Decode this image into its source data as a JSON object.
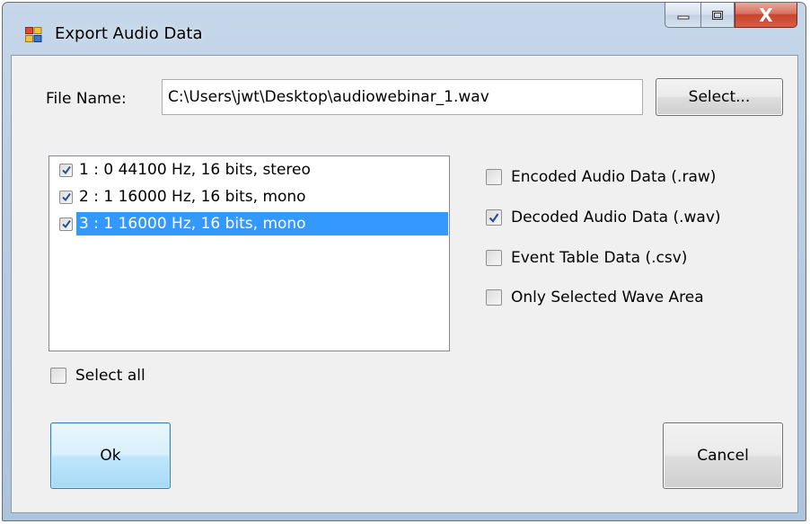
{
  "window": {
    "title": "Export Audio Data",
    "close_glyph": "X"
  },
  "file": {
    "label": "File Name:",
    "value": "C:\\Users\\jwt\\Desktop\\audiowebinar_1.wav",
    "select_label": "Select..."
  },
  "tracks": [
    {
      "label": "1 : 0 44100 Hz, 16 bits, stereo",
      "checked": true,
      "selected": false
    },
    {
      "label": "2 : 1 16000 Hz, 16 bits, mono",
      "checked": true,
      "selected": false
    },
    {
      "label": "3 : 1 16000 Hz, 16 bits, mono",
      "checked": true,
      "selected": true
    }
  ],
  "options": [
    {
      "label": "Encoded Audio Data (.raw)",
      "checked": false
    },
    {
      "label": "Decoded Audio Data (.wav)",
      "checked": true
    },
    {
      "label": "Event Table Data (.csv)",
      "checked": false
    },
    {
      "label": "Only Selected Wave Area",
      "checked": false
    }
  ],
  "select_all": {
    "label": "Select all",
    "checked": false
  },
  "buttons": {
    "ok": "Ok",
    "cancel": "Cancel"
  },
  "colors": {
    "selection": "#3399ff",
    "check": "#2b4e96"
  }
}
